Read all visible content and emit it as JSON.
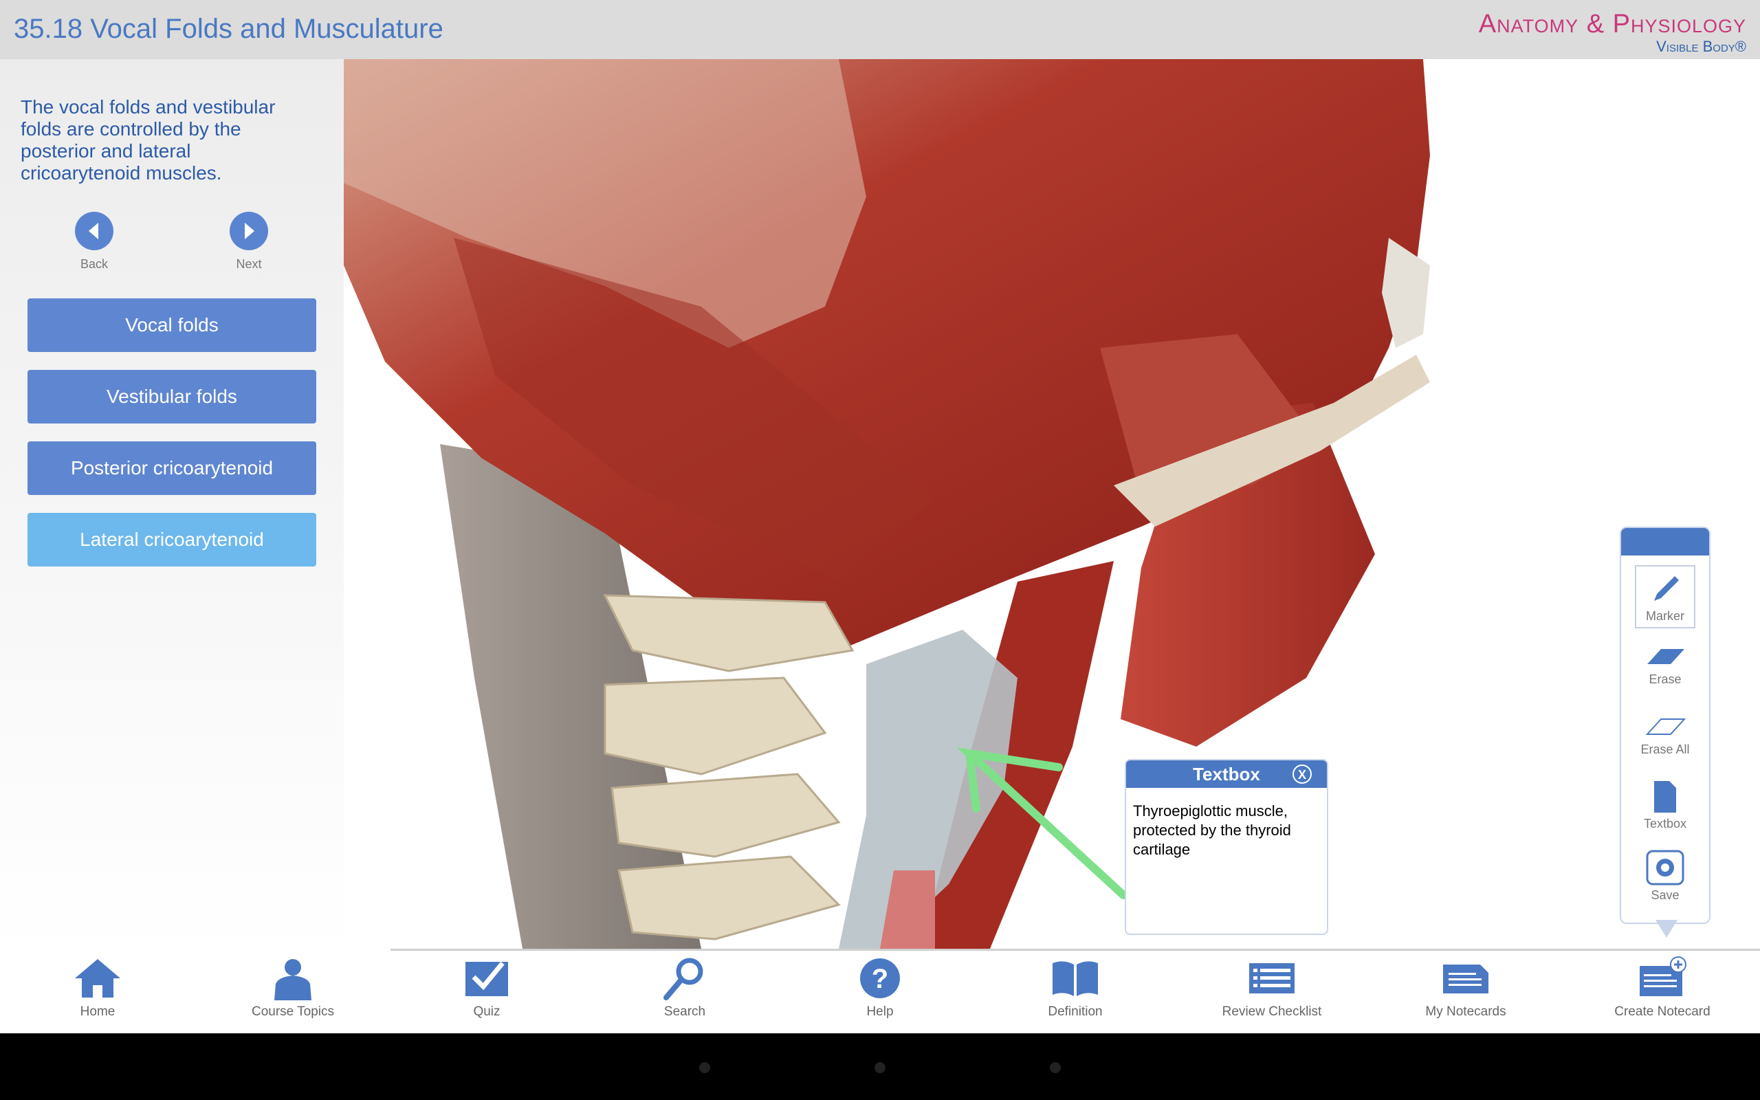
{
  "header": {
    "title": "35.18 Vocal Folds and Musculature",
    "brand_line1": "Anatomy & Physiology",
    "brand_line2": "Visible Body®"
  },
  "sidebar": {
    "intro": "The vocal folds and vestibular folds are controlled by the posterior and lateral cricoarytenoid muscles.",
    "back_label": "Back",
    "next_label": "Next",
    "topics": [
      {
        "label": "Vocal folds",
        "active": false
      },
      {
        "label": "Vestibular folds",
        "active": false
      },
      {
        "label": "Posterior cricoarytenoid",
        "active": false
      },
      {
        "label": "Lateral cricoarytenoid",
        "active": true
      }
    ]
  },
  "viewport": {
    "description_icon": "3d-anatomy-view"
  },
  "textbox": {
    "title": "Textbox",
    "close_label": "X",
    "content": "Thyroepiglottic muscle, protected by the thyroid cartilage"
  },
  "tools": {
    "marker": "Marker",
    "erase": "Erase",
    "erase_all": "Erase All",
    "textbox": "Textbox",
    "save": "Save",
    "selected": "Marker"
  },
  "bottom_bar": {
    "home": "Home",
    "course_topics": "Course Topics",
    "quiz": "Quiz",
    "search": "Search",
    "help": "Help",
    "definition": "Definition",
    "review_checklist": "Review Checklist",
    "my_notecards": "My Notecards",
    "create_notecard": "Create Notecard"
  },
  "colors": {
    "accent": "#4a78c2",
    "brand_pink": "#c8387a",
    "active_topic": "#6db8ec",
    "marker_stroke": "#7fe08a"
  }
}
